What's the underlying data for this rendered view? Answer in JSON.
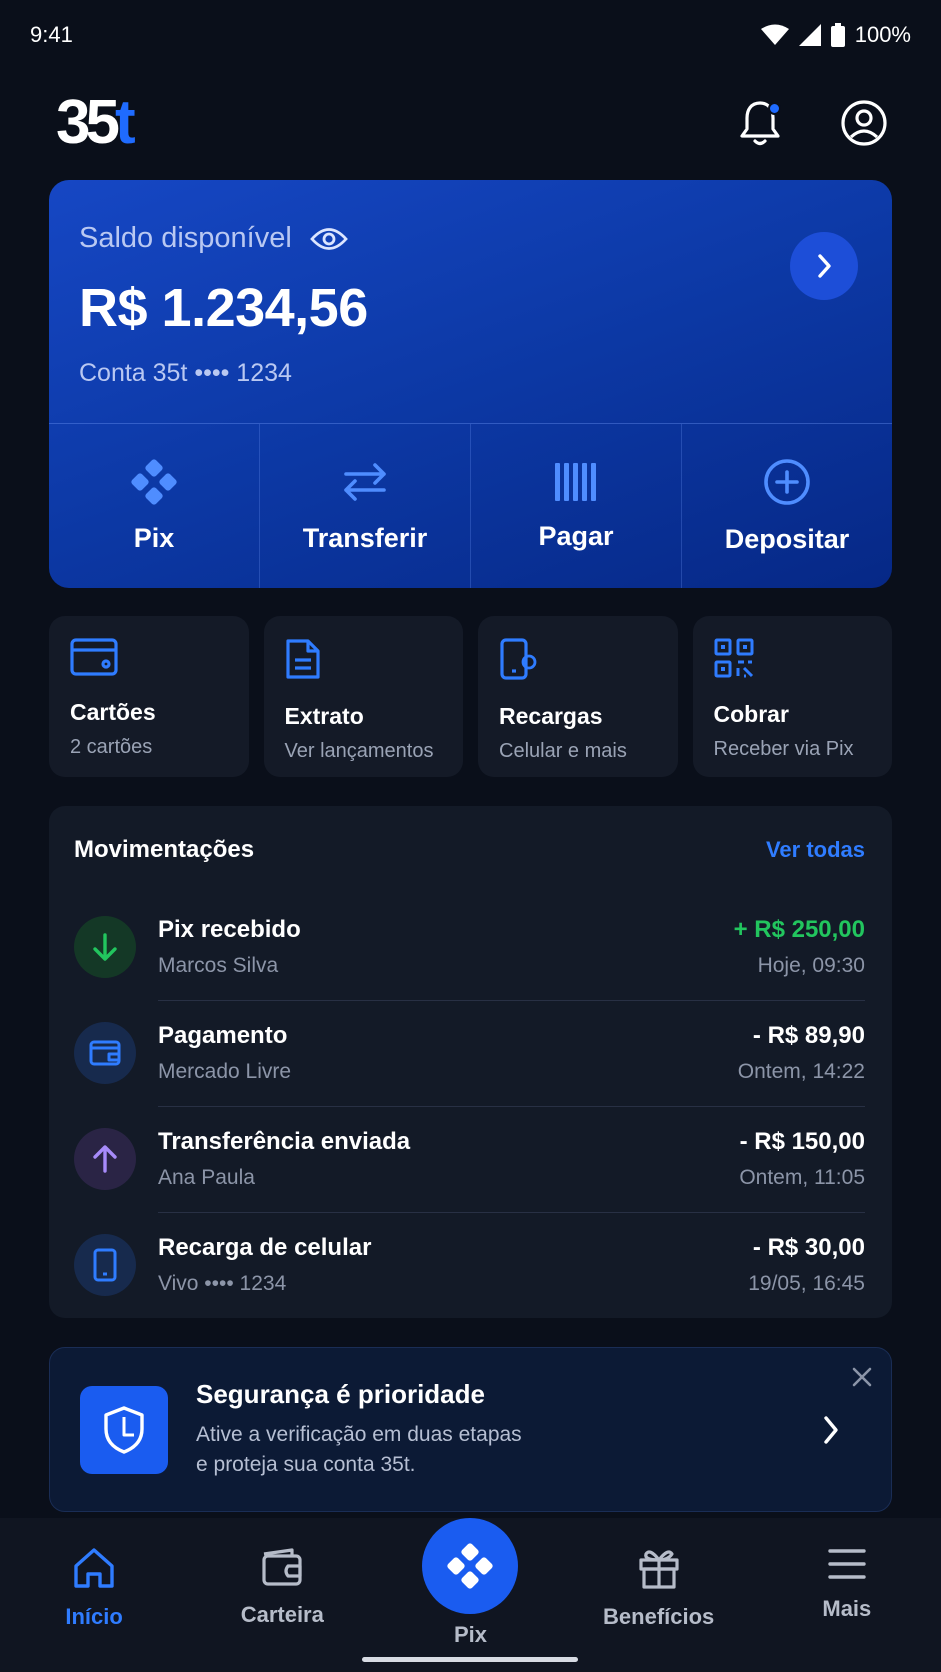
{
  "status_bar": {
    "time": "9:41",
    "battery": "100%"
  },
  "header": {
    "logo_main": "35",
    "logo_accent": "t"
  },
  "balance": {
    "label": "Saldo disponível",
    "amount": "R$ 1.234,56",
    "account": "Conta 35t •••• 1234"
  },
  "quick_actions": [
    {
      "label": "Pix",
      "icon": "pix-icon"
    },
    {
      "label": "Transferir",
      "icon": "transfer-icon"
    },
    {
      "label": "Pagar",
      "icon": "barcode-icon"
    },
    {
      "label": "Depositar",
      "icon": "plus-circle-icon"
    }
  ],
  "shortcuts": [
    {
      "title": "Cartões",
      "subtitle": "2 cartões",
      "icon": "card-icon"
    },
    {
      "title": "Extrato",
      "subtitle": "Ver lançamentos",
      "icon": "document-icon"
    },
    {
      "title": "Recargas",
      "subtitle": "Celular e mais",
      "icon": "phone-recharge-icon"
    },
    {
      "title": "Cobrar",
      "subtitle": "Receber via Pix",
      "icon": "qr-code-icon"
    }
  ],
  "transactions": {
    "title": "Movimentações",
    "see_all": "Ver todas",
    "items": [
      {
        "name": "Pix recebido",
        "detail": "Marcos Silva",
        "amount": "+ R$ 250,00",
        "date": "Hoje, 09:30",
        "icon": "arrow-down-icon"
      },
      {
        "name": "Pagamento",
        "detail": "Mercado Livre",
        "amount": "- R$ 89,90",
        "date": "Ontem, 14:22",
        "icon": "wallet-icon"
      },
      {
        "name": "Transferência enviada",
        "detail": "Ana Paula",
        "amount": "- R$ 150,00",
        "date": "Ontem, 11:05",
        "icon": "arrow-up-icon"
      },
      {
        "name": "Recarga de celular",
        "detail": "Vivo •••• 1234",
        "amount": "- R$ 30,00",
        "date": "19/05, 16:45",
        "icon": "phone-icon"
      }
    ]
  },
  "security": {
    "title": "Segurança é prioridade",
    "line1": "Ative a verificação em duas etapas",
    "line2": "e proteja sua conta 35t."
  },
  "bottom_nav": [
    {
      "label": "Início",
      "icon": "home-icon",
      "active": true
    },
    {
      "label": "Carteira",
      "icon": "wallet-icon",
      "active": false
    },
    {
      "label": "Pix",
      "icon": "pix-icon",
      "active": false
    },
    {
      "label": "Benefícios",
      "icon": "gift-icon",
      "active": false
    },
    {
      "label": "Mais",
      "icon": "menu-icon",
      "active": false
    }
  ],
  "colors": {
    "background": "#0a0f1a",
    "accent": "#1f6bff",
    "positive": "#22c55e",
    "card_blue": "#0d3aa8"
  }
}
